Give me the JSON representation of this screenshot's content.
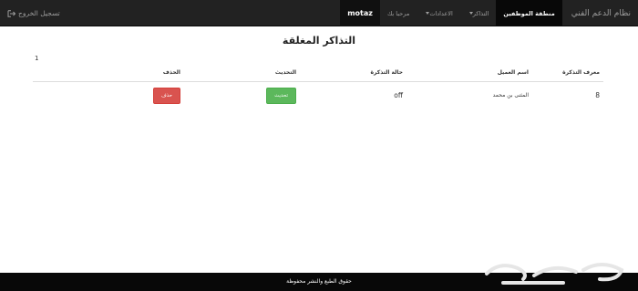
{
  "navbar": {
    "logout_label": "تسجيل الخروج",
    "user_label": "motaz",
    "welcome_label": "مرحبا بك",
    "settings_label": "الاعدادات",
    "tickets_label": "التذاكر",
    "staff_area_label": "منطقة الموظفين",
    "brand": "نظام الدعم الفني"
  },
  "main": {
    "title": "التذاكر المغلقة",
    "page_number": "1"
  },
  "table": {
    "headers": {
      "id": "معرف التذكرة",
      "client": "اسم العميل",
      "status": "حالة التذكرة",
      "update": "التحديث",
      "delete": "الحذف"
    },
    "rows": [
      {
        "id": "8",
        "client": "المثنى بن محمد",
        "status": "off",
        "update_btn": "تحديث",
        "delete_btn": "حذف"
      }
    ]
  },
  "footer": {
    "text": "حقوق الطبع والنشر محفوظة"
  },
  "colors": {
    "navbar_bg": "#222222",
    "success": "#5cb85c",
    "danger": "#d9534f",
    "footer_bg": "#080808"
  }
}
